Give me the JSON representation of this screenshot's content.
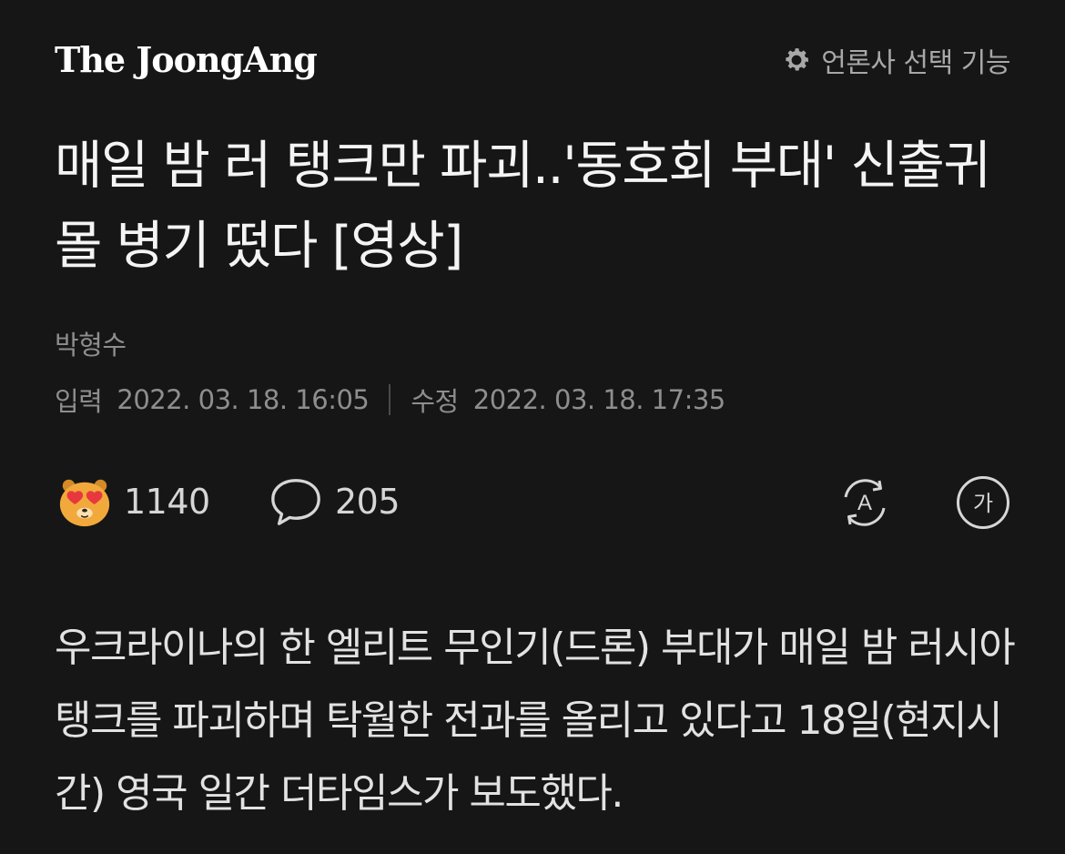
{
  "header": {
    "logo_text": "The JoongAng",
    "press_select_label": "언론사 선택 기능",
    "press_select_icon": "gear-icon"
  },
  "article": {
    "headline": "매일 밤 러 탱크만 파괴..'동호회 부대' 신출귀몰 병기 떴다 [영상]",
    "author": "박형수",
    "published_label": "입력",
    "published": "2022. 03. 18. 16:05",
    "modified_label": "수정",
    "modified": "2022. 03. 18. 17:35",
    "body": "우크라이나의 한 엘리트 무인기(드론) 부대가 매일 밤 러시아 탱크를 파괴하며 탁월한 전과를 올리고 있다고 18일(현지시간) 영국 일간 더타임스가 보도했다."
  },
  "actions": {
    "reaction_icon": "heart-eyes-emoji-icon",
    "reaction_count": "1140",
    "comment_icon": "speech-bubble-icon",
    "comment_count": "205",
    "translate_icon": "translate-icon",
    "translate_label": "A",
    "font_size_icon": "font-size-icon",
    "font_size_label": "가"
  },
  "colors": {
    "background": "#161616",
    "headline": "#f4f4f4",
    "meta_text": "#8e8e8e",
    "body_text": "#e2e2e2",
    "emoji_face": "#f2a93b",
    "emoji_heart": "#e8383f"
  }
}
